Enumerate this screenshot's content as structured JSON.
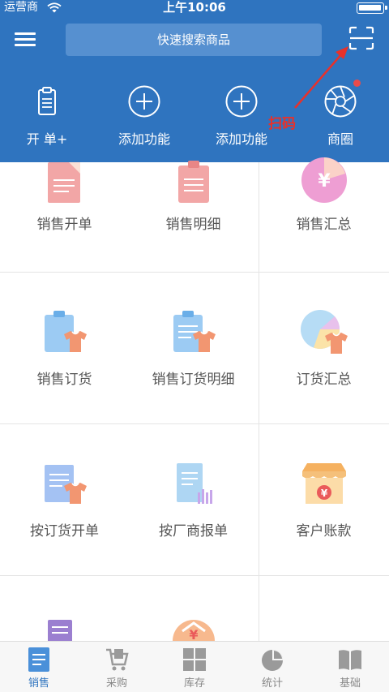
{
  "status_bar": {
    "carrier": "运营商",
    "time": "上午10:06"
  },
  "header": {
    "search_placeholder": "快速搜索商品",
    "quick_actions": [
      {
        "label": "开 单+",
        "icon": "clipboard-icon"
      },
      {
        "label": "添加功能",
        "icon": "plus-circle-icon"
      },
      {
        "label": "添加功能",
        "icon": "plus-circle-icon"
      },
      {
        "label": "商圈",
        "icon": "aperture-icon"
      }
    ],
    "annotation": "扫码"
  },
  "grid": {
    "items": [
      {
        "label": "销售开单",
        "icon": "sales-order-icon"
      },
      {
        "label": "销售明细",
        "icon": "sales-detail-icon"
      },
      {
        "label": "销售汇总",
        "icon": "sales-summary-icon"
      },
      {
        "label": "销售订货",
        "icon": "sales-booking-icon"
      },
      {
        "label": "销售订货明细",
        "icon": "booking-detail-icon"
      },
      {
        "label": "订货汇总",
        "icon": "booking-summary-icon"
      },
      {
        "label": "按订货开单",
        "icon": "order-by-booking-icon"
      },
      {
        "label": "按厂商报单",
        "icon": "vendor-report-icon"
      },
      {
        "label": "客户账款",
        "icon": "customer-account-icon"
      }
    ]
  },
  "tabbar": {
    "tabs": [
      {
        "label": "销售",
        "icon": "document-icon",
        "active": true
      },
      {
        "label": "采购",
        "icon": "cart-icon",
        "active": false
      },
      {
        "label": "库存",
        "icon": "boxes-icon",
        "active": false
      },
      {
        "label": "统计",
        "icon": "pie-chart-icon",
        "active": false
      },
      {
        "label": "基础",
        "icon": "book-icon",
        "active": false
      }
    ]
  },
  "colors": {
    "header_bg": "#2f74bf",
    "active_tab": "#2f74bf",
    "annotation": "#e8312a"
  }
}
